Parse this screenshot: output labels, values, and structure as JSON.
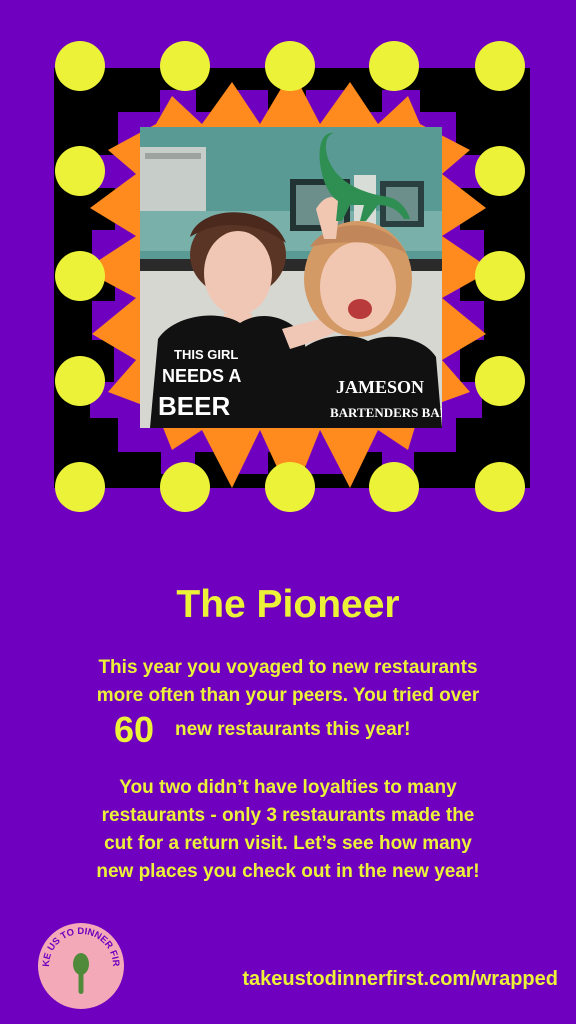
{
  "profile": {
    "title": "The Pioneer",
    "paragraph1": {
      "line1": "This year you voyaged to new restaurants",
      "line2": "more often than your peers. You tried over",
      "count": "60",
      "count_suffix": "new restaurants this year!"
    },
    "paragraph2": {
      "line1": "You two didn’t have loyalties to many",
      "line2": "restaurants - only 3 restaurants made the",
      "line3": "cut for a return visit. Let’s see how many",
      "line4": "new places you check out in the new year!"
    }
  },
  "footer": {
    "logo_text": "TAKE US TO DINNER FIRST",
    "url": "takeustodinnerfirst.com/wrapped"
  },
  "photo": {
    "shirt_left_text": "THIS GIRL NEEDS A BEER",
    "shirt_right_text": "JAMESON BARTENDERS BALL"
  },
  "colors": {
    "background": "#6f00c0",
    "accent_yellow": "#ecf238",
    "orange": "#ff8a1d",
    "logo_pink": "#f4a9b8",
    "logo_green": "#4f8a3b"
  }
}
